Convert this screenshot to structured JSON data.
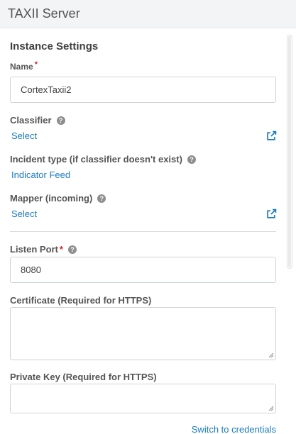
{
  "header": {
    "title": "TAXII Server"
  },
  "instance": {
    "section_title": "Instance Settings",
    "name": {
      "label": "Name",
      "required_mark": "*",
      "value": "CortexTaxii2"
    },
    "classifier": {
      "label": "Classifier",
      "help_glyph": "?",
      "link": "Select"
    },
    "incident_type": {
      "label": "Incident type (if classifier doesn't exist)",
      "help_glyph": "?",
      "link": "Indicator Feed"
    },
    "mapper": {
      "label": "Mapper (incoming)",
      "help_glyph": "?",
      "link": "Select"
    },
    "listen_port": {
      "label": "Listen Port",
      "required_mark": "*",
      "help_glyph": "?",
      "value": "8080"
    },
    "certificate": {
      "label": "Certificate (Required for HTTPS)",
      "value": ""
    },
    "private_key": {
      "label": "Private Key (Required for HTTPS)",
      "value": ""
    },
    "switch_link": "Switch to credentials"
  },
  "icons": {
    "help": "question-circle-icon",
    "external": "external-link-icon",
    "resize": "resize-grip-icon"
  },
  "colors": {
    "link": "#1a7bbf",
    "required": "#d6232b",
    "header_bg": "#f2f4f5",
    "border": "#cfd3d6"
  }
}
